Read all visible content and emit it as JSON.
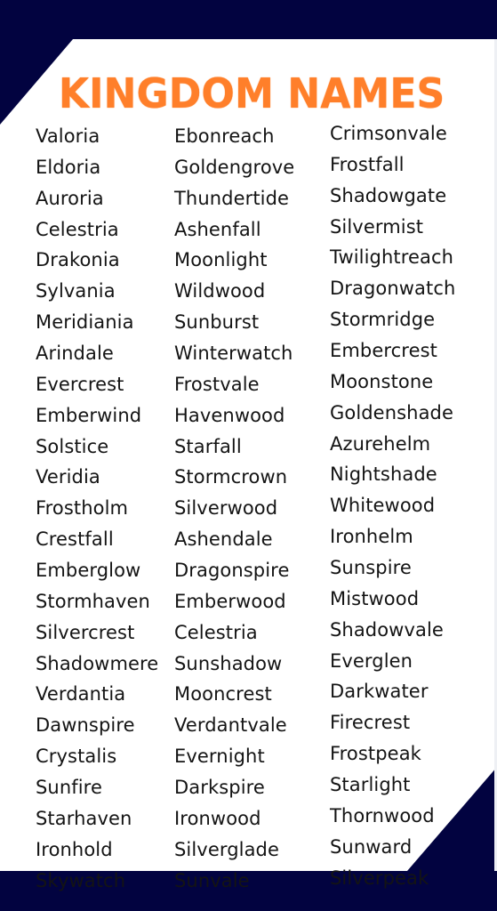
{
  "title": "KINGDOM NAMES",
  "colors": {
    "navy": "#020340",
    "title_orange": "#ff7f2a",
    "text": "#141414",
    "background": "#ffffff"
  },
  "columns": [
    {
      "names": [
        "Valoria",
        "Eldoria",
        "Auroria",
        "Celestria",
        "Drakonia",
        "Sylvania",
        "Meridiania",
        "Arindale",
        "Evercrest",
        "Emberwind",
        "Solstice",
        "Veridia",
        "Frostholm",
        "Crestfall",
        "Emberglow",
        "Stormhaven",
        "Silvercrest",
        "Shadowmere",
        "Verdantia",
        "Dawnspire",
        "Crystalis",
        "Sunfire",
        "Starhaven",
        "Ironhold",
        "Skywatch"
      ]
    },
    {
      "names": [
        "Ebonreach",
        "Goldengrove",
        "Thundertide",
        "Ashenfall",
        "Moonlight",
        "Wildwood",
        "Sunburst",
        "Winterwatch",
        "Frostvale",
        "Havenwood",
        "Starfall",
        "Stormcrown",
        "Silverwood",
        "Ashendale",
        "Dragonspire",
        "Emberwood",
        "Celestria",
        "Sunshadow",
        "Mooncrest",
        "Verdantvale",
        "Evernight",
        "Darkspire",
        "Ironwood",
        "Silverglade",
        "Sunvale"
      ]
    },
    {
      "names": [
        "Crimsonvale",
        "Frostfall",
        "Shadowgate",
        "Silvermist",
        "Twilightreach",
        "Dragonwatch",
        "Stormridge",
        "Embercrest",
        "Moonstone",
        "Goldenshade",
        "Azurehelm",
        "Nightshade",
        "Whitewood",
        "Ironhelm",
        "Sunspire",
        "Mistwood",
        "Shadowvale",
        "Everglen",
        "Darkwater",
        "Firecrest",
        "Frostpeak",
        "Starlight",
        "Thornwood",
        "Sunward",
        "Silverpeak"
      ]
    }
  ]
}
